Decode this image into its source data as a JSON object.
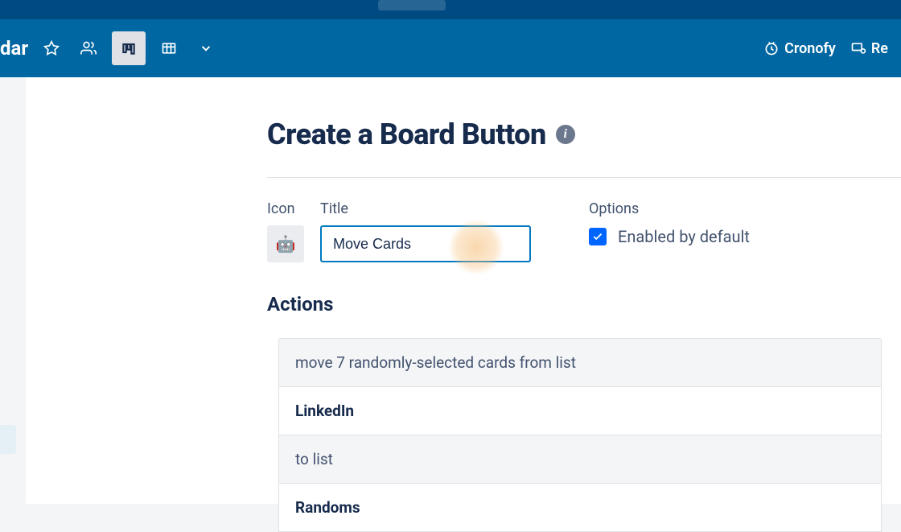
{
  "header": {
    "board_name_partial": "dar",
    "powerups": [
      {
        "icon": "cronofy-icon",
        "label": "Cronofy"
      },
      {
        "icon": "generic-icon",
        "label": "Re"
      }
    ]
  },
  "page": {
    "title": "Create a Board Button"
  },
  "form": {
    "icon_label": "Icon",
    "title_label": "Title",
    "title_value": "Move Cards",
    "options_label": "Options",
    "enabled_label": "Enabled by default",
    "enabled_checked": true
  },
  "actions": {
    "heading": "Actions",
    "segments": [
      {
        "type": "text",
        "value": "move 7 randomly-selected cards from list"
      },
      {
        "type": "selection",
        "value": "LinkedIn"
      },
      {
        "type": "text",
        "value": "to list"
      },
      {
        "type": "selection",
        "value": "Randoms"
      }
    ]
  }
}
